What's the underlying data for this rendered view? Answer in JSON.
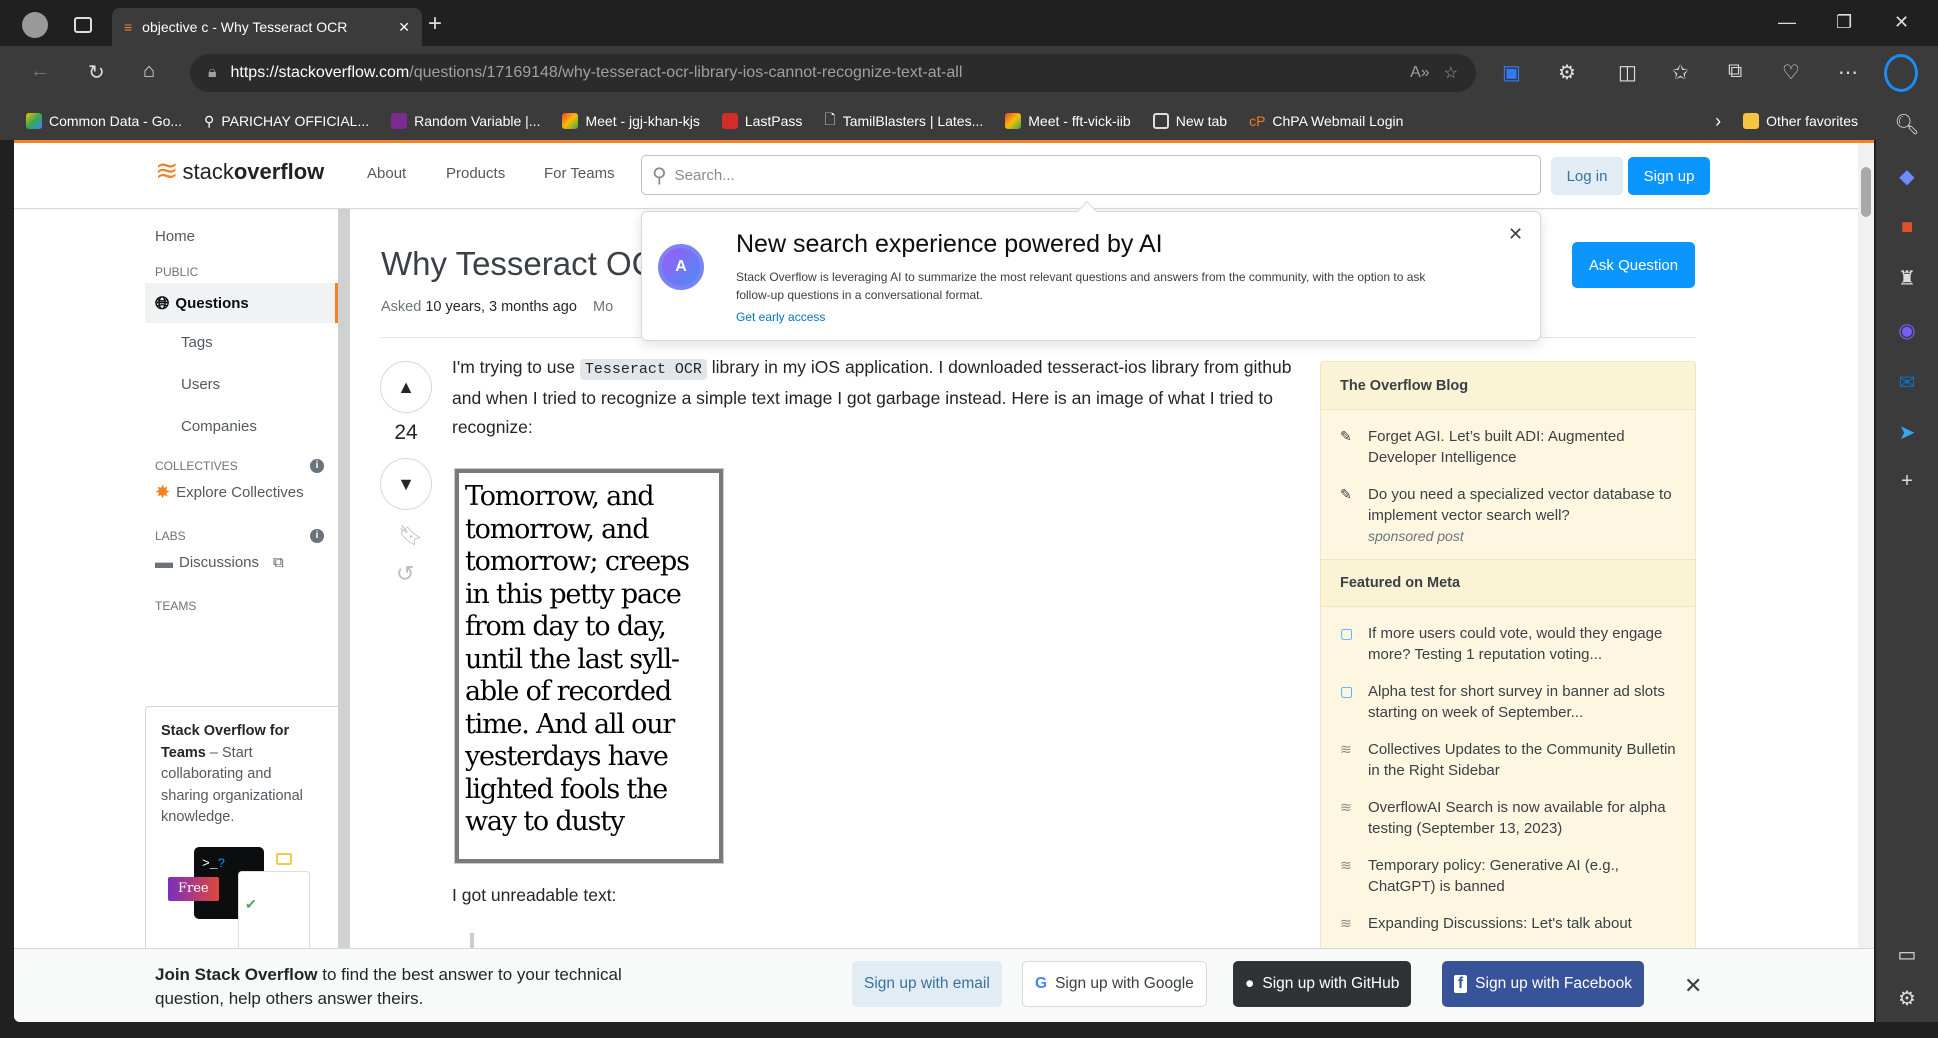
{
  "browser": {
    "tab_title": "objective c - Why Tesseract OCR",
    "url_host": "https://stackoverflow.com",
    "url_path": "/questions/17169148/why-tesseract-ocr-library-ios-cannot-recognize-text-at-all",
    "bookmarks": [
      "Common Data - Go...",
      "PARICHAY OFFICIAL...",
      "Random Variable |...",
      "Meet - jgj-khan-kjs",
      "LastPass",
      "TamilBlasters | Lates...",
      "Meet - fft-vick-iib",
      "New tab",
      "ChPA Webmail Login"
    ],
    "other_favorites": "Other favorites"
  },
  "header": {
    "logo_a": "stack",
    "logo_b": "overflow",
    "nav": [
      "About",
      "Products",
      "For Teams"
    ],
    "search_placeholder": "Search...",
    "login": "Log in",
    "signup": "Sign up"
  },
  "leftnav": {
    "home": "Home",
    "public": "PUBLIC",
    "questions": "Questions",
    "tags": "Tags",
    "users": "Users",
    "companies": "Companies",
    "collectives": "COLLECTIVES",
    "explore": "Explore Collectives",
    "labs": "LABS",
    "discussions": "Discussions",
    "teams": "TEAMS",
    "teams_title": "Stack Overflow for Teams",
    "teams_text": " – Start collaborating and sharing organizational knowledge.",
    "free_badge": "Free"
  },
  "question": {
    "title": "Why Tesseract OC",
    "asked_label": "Asked",
    "asked_value": "10 years, 3 months ago",
    "modified_label": "Mo",
    "ask_button": "Ask Question",
    "votes": "24",
    "p1_a": "I'm trying to use ",
    "p1_code": "Tesseract OCR",
    "p1_b": " library in my iOS application. I downloaded tesseract-ios library from github and when I tried to recognize a simple text image I got garbage instead. Here is an image of what I tried to recognize:",
    "image_text": "Tomorrow, and tomorrow, and tomorrow; creeps in this petty pace from day to day, until the last syll-able of recorded time. And all our yesterdays have lighted fools the way to dusty",
    "p2": "I got unreadable text:"
  },
  "popup": {
    "title": "New search experience powered by AI",
    "text": "Stack Overflow is leveraging AI to summarize the most relevant questions and answers from the community, with the option to ask follow-up questions in a conversational format.",
    "link": "Get early access"
  },
  "sidebar": {
    "blog_title": "The Overflow Blog",
    "blog": [
      "Forget AGI. Let’s built ADI: Augmented Developer Intelligence",
      "Do you need a specialized vector database to implement vector search well?"
    ],
    "sponsored": "sponsored post",
    "meta_title": "Featured on Meta",
    "meta": [
      "If more users could vote, would they engage more? Testing 1 reputation voting...",
      "Alpha test for short survey in banner ad slots starting on week of September...",
      "Collectives Updates to the Community Bulletin in the Right Sidebar",
      "OverflowAI Search is now available for alpha testing (September 13, 2023)",
      "Temporary policy: Generative AI (e.g., ChatGPT) is banned",
      "Expanding Discussions: Let's talk about"
    ]
  },
  "banner": {
    "bold": "Join Stack Overflow",
    "text": " to find the best answer to your technical question, help others answer theirs.",
    "email": "Sign up with email",
    "google": "Sign up with Google",
    "github": "Sign up with GitHub",
    "facebook": "Sign up with Facebook"
  },
  "colors": {
    "accent": "#f48225",
    "primary": "#0a95ff",
    "github": "#2f3337",
    "facebook": "#385499"
  }
}
